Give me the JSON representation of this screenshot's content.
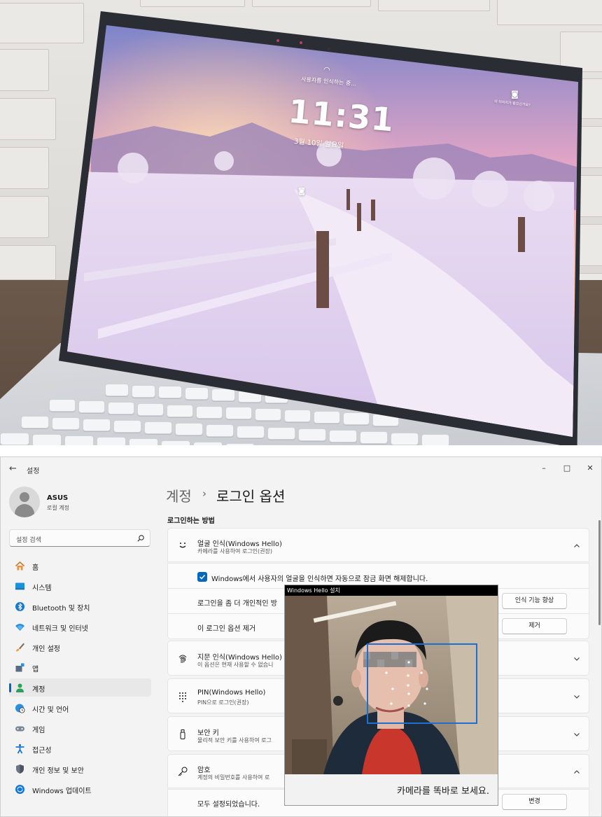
{
  "lock_screen": {
    "status": "사용자를 인식하는 중...",
    "time": "11:31",
    "date": "3월 10일 일요일",
    "corner_hint": "이 이미지가 좋으신가요?"
  },
  "window": {
    "app_title": "설정",
    "minimize": "–",
    "maximize": "□",
    "close": "✕"
  },
  "profile": {
    "name": "ASUS",
    "account_type": "로컬 계정"
  },
  "search": {
    "placeholder": "설정 검색"
  },
  "sidebar": {
    "items": [
      {
        "label": "홈",
        "icon": "home-icon"
      },
      {
        "label": "시스템",
        "icon": "system-icon"
      },
      {
        "label": "Bluetooth 및 장치",
        "icon": "bluetooth-icon"
      },
      {
        "label": "네트워크 및 인터넷",
        "icon": "wifi-icon"
      },
      {
        "label": "개인 설정",
        "icon": "brush-icon"
      },
      {
        "label": "앱",
        "icon": "apps-icon"
      },
      {
        "label": "계정",
        "icon": "account-icon",
        "active": true
      },
      {
        "label": "시간 및 언어",
        "icon": "globe-clock-icon"
      },
      {
        "label": "게임",
        "icon": "gamepad-icon"
      },
      {
        "label": "접근성",
        "icon": "accessibility-icon"
      },
      {
        "label": "개인 정보 및 보안",
        "icon": "shield-icon"
      },
      {
        "label": "Windows 업데이트",
        "icon": "update-icon"
      }
    ]
  },
  "header": {
    "parent": "계정",
    "separator": "›",
    "current": "로그인 옵션"
  },
  "signin": {
    "section_title": "로그인하는 방법",
    "face": {
      "title": "얼굴 인식(Windows Hello)",
      "subtitle": "카메라를 사용하여 로그인(권장)",
      "auto_dismiss_label": "Windows에서 사용자의 얼굴을 인식하면 자동으로 잠금 화면 해제합니다.",
      "improve_label": "로그인을 좀 더 개인적인 방",
      "improve_button": "인식 기능 향상",
      "remove_label": "이 로그인 옵션 제거",
      "remove_button": "제거"
    },
    "fingerprint": {
      "title": "지문 인식(Windows Hello)",
      "subtitle": "이 옵션은 현재 사용할 수 없습니"
    },
    "pin": {
      "title": "PIN(Windows Hello)",
      "subtitle": "PIN으로 로그인(권장)"
    },
    "security_key": {
      "title": "보안 키",
      "subtitle": "물리적 보안 키를 사용하여 로그"
    },
    "password": {
      "title": "암호",
      "subtitle": "계정의 비밀번호를 사용하여 로",
      "status_label": "모두 설정되었습니다.",
      "change_button": "변경"
    }
  },
  "hello_dialog": {
    "title": "Windows Hello 설치",
    "message": "카메라를 똑바로 보세요."
  },
  "colors": {
    "accent": "#0067c0",
    "window_bg": "#f3f3f3",
    "card_bg": "#fbfbfb"
  }
}
